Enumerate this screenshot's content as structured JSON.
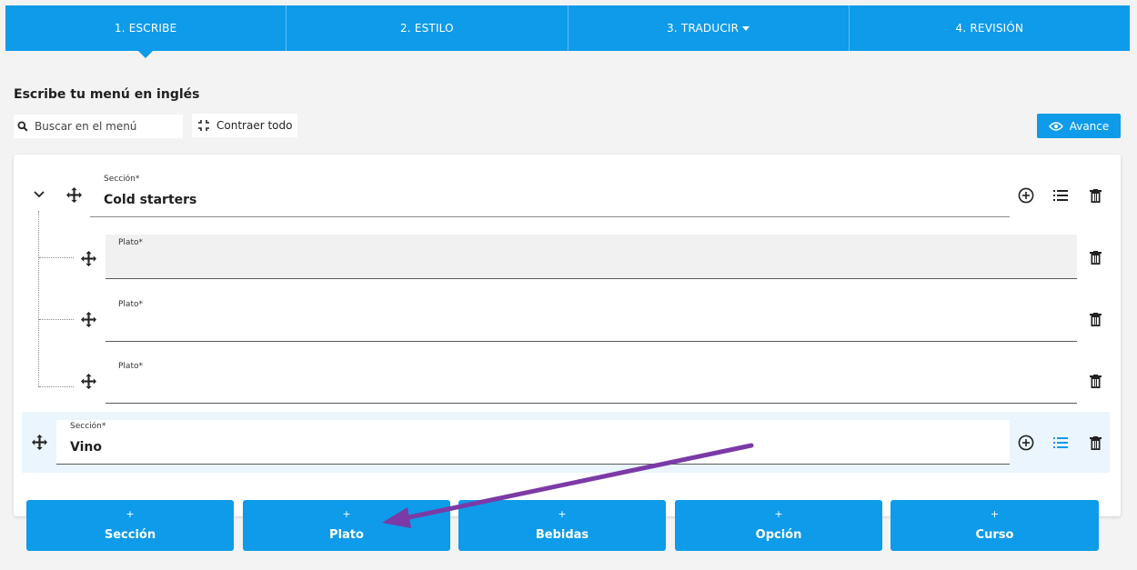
{
  "tabs": [
    {
      "label": "1. ESCRIBE"
    },
    {
      "label": "2. ESTILO"
    },
    {
      "label": "3. TRADUCIR"
    },
    {
      "label": "4. REVISIÓN"
    }
  ],
  "editor": {
    "heading": "Escribe tu menú en inglés",
    "search_placeholder": "Buscar en el menú",
    "collapse_label": "Contraer todo",
    "preview_label": "Avance"
  },
  "sections": [
    {
      "field_label": "Sección*",
      "name": "Cold starters",
      "dishes": [
        {
          "field_label": "Plato*",
          "value": ""
        },
        {
          "field_label": "Plato*",
          "value": ""
        },
        {
          "field_label": "Plato*",
          "value": ""
        }
      ]
    },
    {
      "field_label": "Sección*",
      "name": "Vino"
    }
  ],
  "add_buttons": {
    "plus": "+",
    "items": [
      {
        "label": "Sección"
      },
      {
        "label": "Plato"
      },
      {
        "label": "Bebidas"
      },
      {
        "label": "Opción"
      },
      {
        "label": "Curso"
      }
    ]
  },
  "colors": {
    "primary": "#0e9be9",
    "annotation_arrow": "#7b3aa6",
    "highlight_row": "#eaf5fd"
  }
}
